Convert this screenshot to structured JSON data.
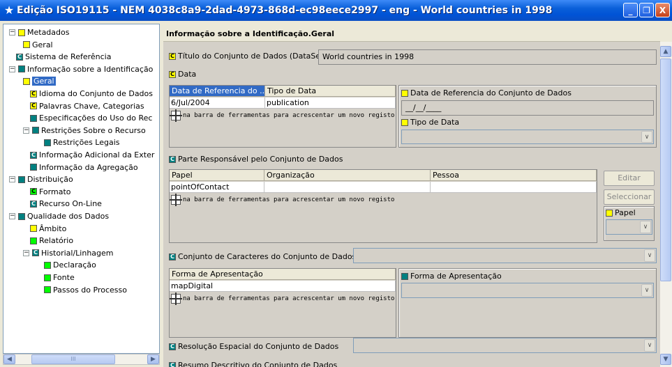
{
  "window": {
    "title": "Edição ISO19115 - NEM 4038c8a9-2dad-4973-868d-ec98eece2997 - eng - World countries in 1998",
    "minimize": "_",
    "restore": "❐",
    "close": "X"
  },
  "tree": {
    "items": [
      {
        "label": "Metadados",
        "icon": "yellow",
        "expander": "−"
      },
      {
        "label": "Geral",
        "icon": "yellow"
      },
      {
        "label": "Sistema de Referência",
        "icon": "teal-c"
      },
      {
        "label": "Informação sobre a Identificação",
        "icon": "teal",
        "expander": "−"
      },
      {
        "label": "Geral",
        "icon": "yellow",
        "selected": true
      },
      {
        "label": "Idioma do Conjunto de Dados",
        "icon": "yellow-c"
      },
      {
        "label": "Palavras Chave, Categorias",
        "icon": "yellow-c"
      },
      {
        "label": "Especificações do Uso do Rec",
        "icon": "teal"
      },
      {
        "label": "Restrições Sobre o Recurso",
        "icon": "teal",
        "expander": "−"
      },
      {
        "label": "Restrições Legais",
        "icon": "teal"
      },
      {
        "label": "Informação Adicional da Exter",
        "icon": "teal-c"
      },
      {
        "label": "Informação da Agregação",
        "icon": "teal"
      },
      {
        "label": "Distribuição",
        "icon": "teal",
        "expander": "−"
      },
      {
        "label": "Formato",
        "icon": "green-c"
      },
      {
        "label": "Recurso On-Line",
        "icon": "teal-c"
      },
      {
        "label": "Qualidade dos Dados",
        "icon": "teal",
        "expander": "−"
      },
      {
        "label": "Âmbito",
        "icon": "yellow"
      },
      {
        "label": "Relatório",
        "icon": "green"
      },
      {
        "label": "Historial/Linhagem",
        "icon": "teal-c",
        "expander": "−"
      },
      {
        "label": "Declaração",
        "icon": "green"
      },
      {
        "label": "Fonte",
        "icon": "green"
      },
      {
        "label": "Passos do Processo",
        "icon": "green"
      }
    ],
    "scroll_thumb_grip": "III"
  },
  "panel": {
    "header": "Informação sobre a Identificação.Geral",
    "titulo_label": "Título do Conjunto de Dados (DataSet)",
    "titulo_value": "World countries in 1998",
    "data_label": "Data",
    "data_table": {
      "columns": [
        "Data de Referencia do ...",
        "Tipo de Data"
      ],
      "rows": [
        [
          "6/Jul/2004",
          "publication"
        ]
      ]
    },
    "hint": "na barra de ferramentas para acrescentar um novo registo",
    "data_ref_label": "Data de Referencia do Conjunto de Dados",
    "data_ref_value": "__/__/____",
    "tipo_data_label": "Tipo de Data",
    "parte_label": "Parte Responsável pelo Conjunto de Dados",
    "parte_table": {
      "columns": [
        "Papel",
        "Organização",
        "Pessoa"
      ],
      "rows": [
        [
          "pointOfContact",
          "",
          ""
        ]
      ]
    },
    "editar": "Editar",
    "seleccionar": "Seleccionar",
    "papel_label": "Papel",
    "caracteres_label": "Conjunto de Caracteres do Conjunto de Dados",
    "forma_table": {
      "columns": [
        "Forma de Apresentação"
      ],
      "rows": [
        [
          "mapDigital"
        ]
      ]
    },
    "forma_label": "Forma de Apresentação",
    "resolucao_label": "Resolução Espacial do Conjunto de Dados",
    "resumo_label": "Resumo Descritivo do Conjunto de Dados"
  },
  "icon_letter": "C",
  "colors": {
    "title_bar": "#0a5fd9",
    "selection": "#316ac5",
    "yellow_icon": "#ffff00",
    "teal_icon": "#008080",
    "green_icon": "#00ff00"
  }
}
